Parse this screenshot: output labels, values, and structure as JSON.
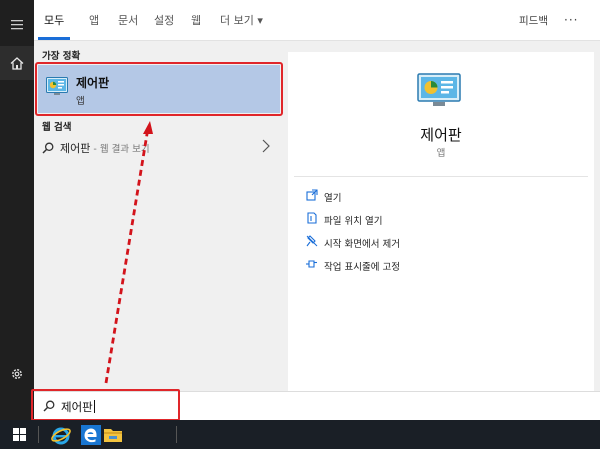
{
  "tabs": [
    {
      "label": "모두",
      "active": true
    },
    {
      "label": "앱"
    },
    {
      "label": "문서"
    },
    {
      "label": "설정"
    },
    {
      "label": "웹"
    },
    {
      "label": "더 보기 ▾"
    }
  ],
  "feedback_label": "피드백",
  "more_label": "···",
  "best_match": {
    "section_label": "가장 정확",
    "title": "제어판",
    "subtitle": "앱"
  },
  "web_search": {
    "section_label": "웹 검색",
    "query": "제어판",
    "suffix": " - 웹 결과 보기"
  },
  "detail": {
    "title": "제어판",
    "subtitle": "앱",
    "actions": [
      {
        "label": "열기",
        "icon": "open-icon"
      },
      {
        "label": "파일 위치 열기",
        "icon": "file-location-icon"
      },
      {
        "label": "시작 화면에서 제거",
        "icon": "unpin-icon"
      },
      {
        "label": "작업 표시줄에 고정",
        "icon": "pin-icon"
      }
    ]
  },
  "search": {
    "value": "제어판"
  },
  "colors": {
    "accent": "#1a6ed8",
    "highlight": "#e0262a",
    "selection": "#b4c8e6"
  }
}
